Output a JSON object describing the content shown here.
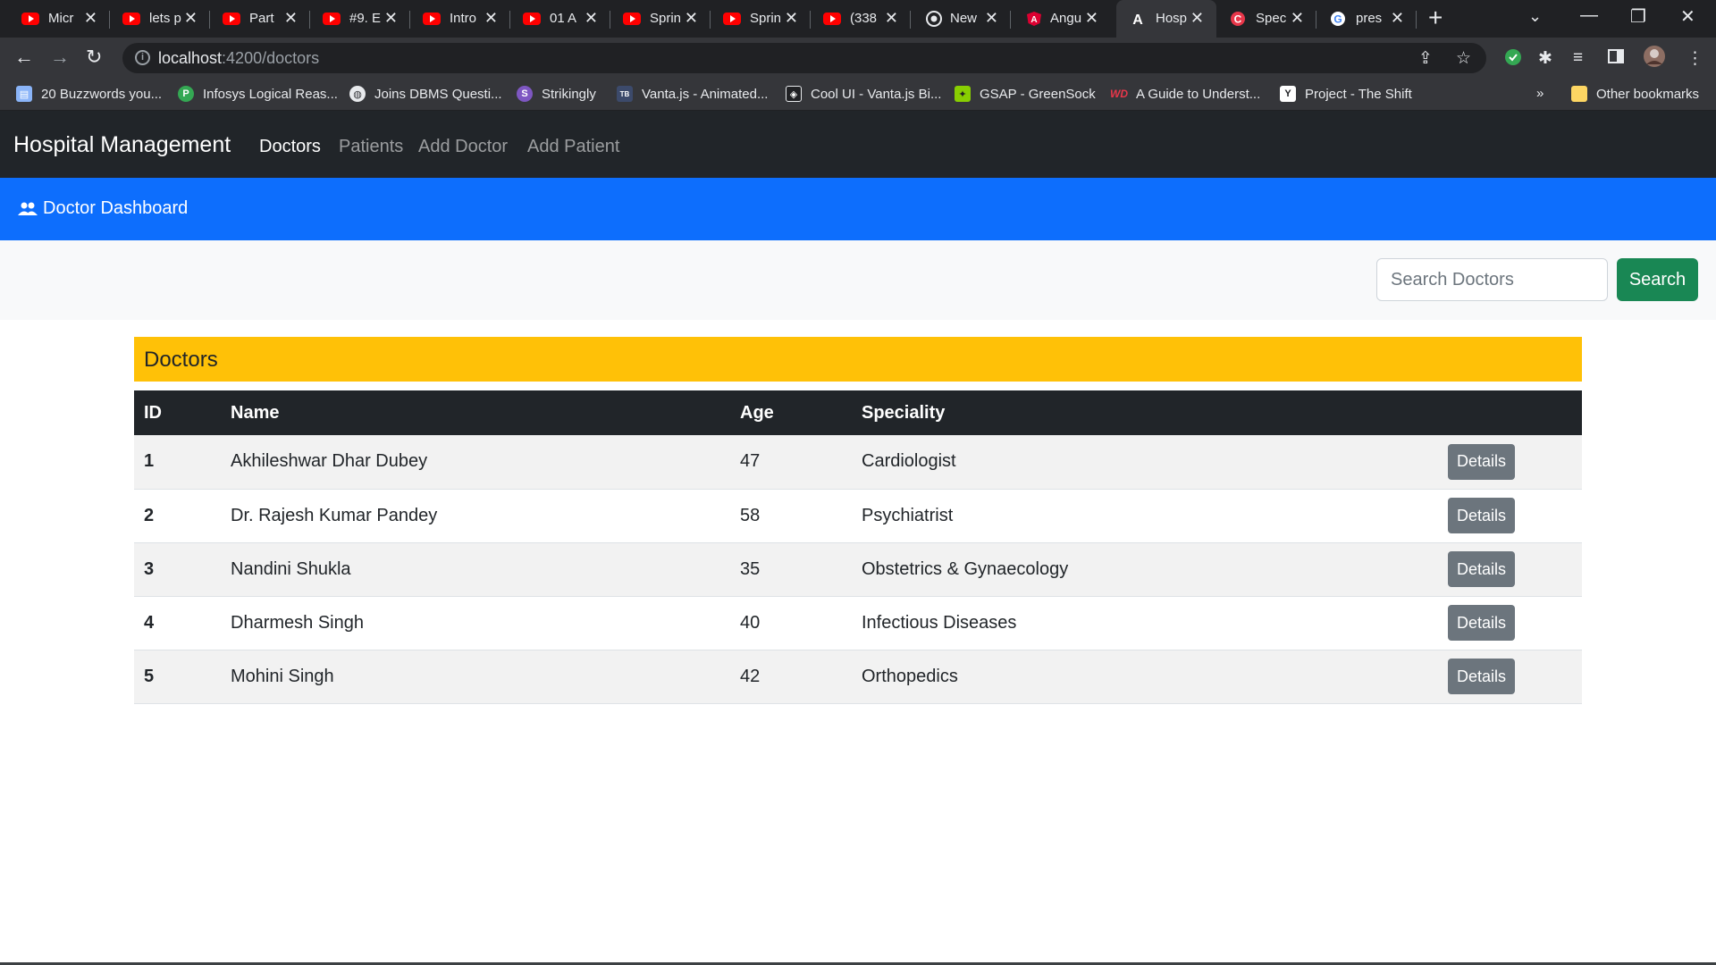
{
  "browser": {
    "tabs": [
      {
        "title": "Micr",
        "icon": "youtube-icon"
      },
      {
        "title": "lets p",
        "icon": "youtube-icon"
      },
      {
        "title": "Part",
        "icon": "youtube-icon"
      },
      {
        "title": "#9. E",
        "icon": "youtube-icon"
      },
      {
        "title": "Intro",
        "icon": "youtube-icon"
      },
      {
        "title": "01 A",
        "icon": "youtube-icon"
      },
      {
        "title": "Sprin",
        "icon": "youtube-icon"
      },
      {
        "title": "Sprin",
        "icon": "youtube-icon"
      },
      {
        "title": "(338",
        "icon": "youtube-icon"
      },
      {
        "title": "New",
        "icon": "chrome-icon"
      },
      {
        "title": "Angu",
        "icon": "angular-icon"
      },
      {
        "title": "Hosp",
        "icon": "angular-logo-icon",
        "active": true
      },
      {
        "title": "Spec",
        "icon": "red-c-icon"
      },
      {
        "title": "pres",
        "icon": "google-icon"
      }
    ],
    "url_host": "localhost",
    "url_path": ":4200/doctors",
    "bookmarks": [
      {
        "label": "20 Buzzwords you...",
        "icon": "doc-icon"
      },
      {
        "label": "Infosys Logical Reas...",
        "icon": "p-icon"
      },
      {
        "label": "Joins DBMS Questi...",
        "icon": "globe-icon"
      },
      {
        "label": "Strikingly",
        "icon": "s-icon"
      },
      {
        "label": "Vanta.js - Animated...",
        "icon": "vanta-icon"
      },
      {
        "label": "Cool UI - Vanta.js Bi...",
        "icon": "codepen-icon"
      },
      {
        "label": "GSAP - GreenSock",
        "icon": "gsap-icon"
      },
      {
        "label": "A Guide to Underst...",
        "icon": "wd-icon"
      },
      {
        "label": "Project - The Shift",
        "icon": "y-icon"
      }
    ],
    "more_bookmarks": "»",
    "other_bookmarks": "Other bookmarks"
  },
  "navbar": {
    "brand": "Hospital Management",
    "links": [
      "Doctors",
      "Patients",
      "Add Doctor",
      "Add Patient"
    ]
  },
  "dashboard": {
    "title": "Doctor Dashboard"
  },
  "search": {
    "placeholder": "Search Doctors",
    "button": "Search"
  },
  "doctors": {
    "heading": "Doctors",
    "columns": [
      "ID",
      "Name",
      "Age",
      "Speciality"
    ],
    "details_label": "Details",
    "rows": [
      {
        "id": "1",
        "name": "Akhileshwar Dhar Dubey",
        "age": "47",
        "speciality": "Cardiologist"
      },
      {
        "id": "2",
        "name": "Dr. Rajesh Kumar Pandey",
        "age": "58",
        "speciality": "Psychiatrist"
      },
      {
        "id": "3",
        "name": "Nandini Shukla",
        "age": "35",
        "speciality": "Obstetrics & Gynaecology"
      },
      {
        "id": "4",
        "name": "Dharmesh Singh",
        "age": "40",
        "speciality": "Infectious Diseases"
      },
      {
        "id": "5",
        "name": "Mohini Singh",
        "age": "42",
        "speciality": "Orthopedics"
      }
    ]
  },
  "colors": {
    "navbar": "#212529",
    "primary": "#0d6efd",
    "success": "#198754",
    "warning": "#ffc107",
    "secondary": "#6c757d"
  }
}
